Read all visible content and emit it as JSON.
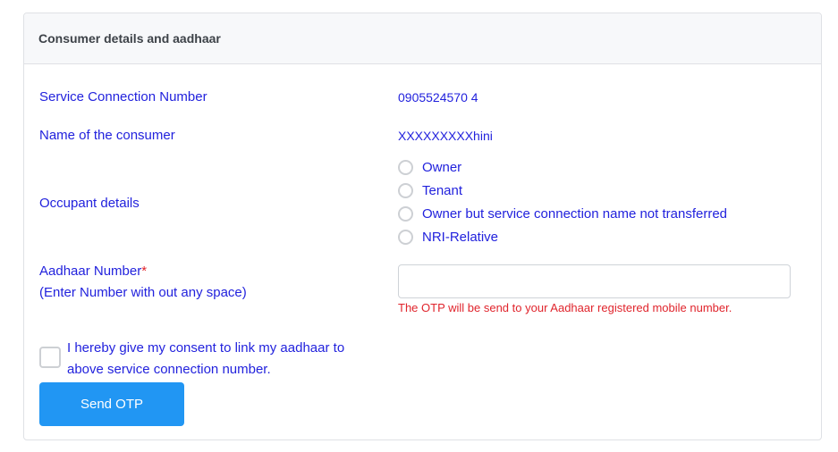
{
  "card": {
    "title": "Consumer details and aadhaar"
  },
  "fields": {
    "service_connection": {
      "label": "Service Connection Number",
      "value": "0905524570 4"
    },
    "consumer_name": {
      "label": "Name of the consumer",
      "value": "XXXXXXXXXhini"
    },
    "occupant": {
      "label": "Occupant details",
      "options": [
        {
          "label": "Owner",
          "selected": false
        },
        {
          "label": "Tenant",
          "selected": false
        },
        {
          "label": "Owner but service connection name not transferred",
          "selected": false
        },
        {
          "label": "NRI-Relative",
          "selected": false
        }
      ]
    },
    "aadhaar": {
      "label": "Aadhaar Number",
      "required_mark": "*",
      "sublabel": "(Enter Number with out any space)",
      "value": "",
      "placeholder": "",
      "hint": "The OTP will be send to your Aadhaar registered mobile number."
    },
    "consent": {
      "label": "I hereby give my consent to link my aadhaar to above service connection number.",
      "checked": false
    }
  },
  "actions": {
    "send_otp_label": "Send OTP"
  },
  "colors": {
    "label": "#2222dd",
    "error": "#e0242c",
    "primary_button": "#2196f3",
    "header_bg": "#f7f8fa"
  }
}
